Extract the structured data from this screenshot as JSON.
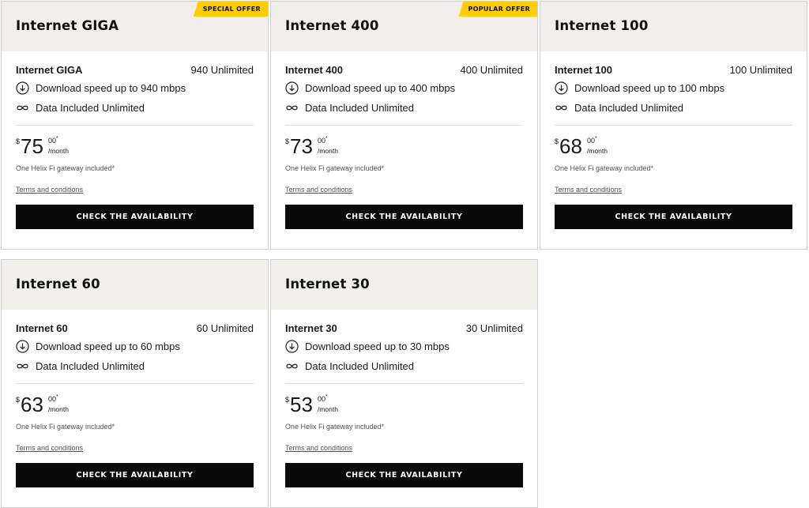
{
  "plans": [
    {
      "title": "Internet GIGA",
      "badge": "SPECIAL OFFER",
      "name": "Internet GIGA",
      "code": "940 Unlimited",
      "download_text": "Download speed up to 940 mbps",
      "data_text": "Data Included Unlimited",
      "currency": "$",
      "price_dollars": "75",
      "price_cents": "00",
      "asterisk": "*",
      "per": "/month",
      "gateway": "One Helix Fi gateway included*",
      "terms": "Terms and conditions",
      "cta": "CHECK THE AVAILABILITY"
    },
    {
      "title": "Internet 400",
      "badge": "POPULAR OFFER",
      "name": "Internet 400",
      "code": "400 Unlimited",
      "download_text": "Download speed up to 400 mbps",
      "data_text": "Data Included Unlimited",
      "currency": "$",
      "price_dollars": "73",
      "price_cents": "00",
      "asterisk": "*",
      "per": "/month",
      "gateway": "One Helix Fi gateway included*",
      "terms": "Terms and conditions",
      "cta": "CHECK THE AVAILABILITY"
    },
    {
      "title": "Internet 100",
      "badge": "",
      "name": "Internet 100",
      "code": "100 Unlimited",
      "download_text": "Download speed up to 100 mbps",
      "data_text": "Data Included Unlimited",
      "currency": "$",
      "price_dollars": "68",
      "price_cents": "00",
      "asterisk": "*",
      "per": "/month",
      "gateway": "One Helix Fi gateway included*",
      "terms": "Terms and conditions",
      "cta": "CHECK THE AVAILABILITY"
    },
    {
      "title": "Internet 60",
      "badge": "",
      "name": "Internet 60",
      "code": "60 Unlimited",
      "download_text": "Download speed up to 60 mbps",
      "data_text": "Data Included Unlimited",
      "currency": "$",
      "price_dollars": "63",
      "price_cents": "00",
      "asterisk": "*",
      "per": "/month",
      "gateway": "One Helix Fi gateway included*",
      "terms": "Terms and conditions",
      "cta": "CHECK THE AVAILABILITY"
    },
    {
      "title": "Internet 30",
      "badge": "",
      "name": "Internet 30",
      "code": "30 Unlimited",
      "download_text": "Download speed up to 30 mbps",
      "data_text": "Data Included Unlimited",
      "currency": "$",
      "price_dollars": "53",
      "price_cents": "00",
      "asterisk": "*",
      "per": "/month",
      "gateway": "One Helix Fi gateway included*",
      "terms": "Terms and conditions",
      "cta": "CHECK THE AVAILABILITY"
    }
  ],
  "icons": {
    "download": "download-arrow-icon",
    "data": "infinity-icon"
  },
  "colors": {
    "badge": "#ffcd00",
    "header_bg": "#f0efeb",
    "cta_bg": "#0a0a0a",
    "cta_text": "#ffffff"
  }
}
